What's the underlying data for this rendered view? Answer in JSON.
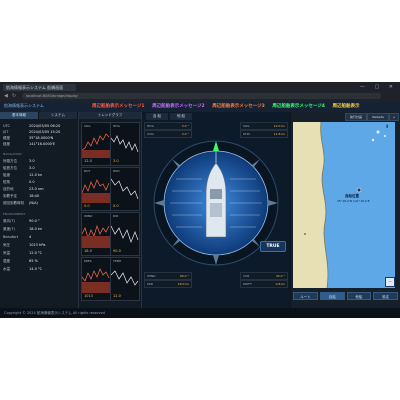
{
  "browser": {
    "tab_title": "航海情報表示システム 船橋画面",
    "url": "localhost:8080/bridge/display",
    "window_controls": "— ▢ ✕"
  },
  "app": {
    "title": "航海情報表示システム",
    "messages": [
      {
        "text": "周辺船舶表示メッセージ1",
        "color": "#ff5a3c"
      },
      {
        "text": "周辺船舶表示メッセージ2",
        "color": "#c86bff"
      },
      {
        "text": "周辺船舶表示メッセージ3",
        "color": "#ff7a3c"
      },
      {
        "text": "周辺船舶表示メッセージ4",
        "color": "#3cff6b"
      },
      {
        "text": "周辺船舶表示",
        "color": "#ffd23c"
      }
    ]
  },
  "left": {
    "tabs": [
      "基本情報",
      "システム"
    ],
    "rows": [
      {
        "k": "UTC",
        "v": "2024/03/05 06:20"
      },
      {
        "k": "JST",
        "v": "2024/03/05 15:20"
      },
      {
        "k": "緯度",
        "v": "35°18.0000'N"
      },
      {
        "k": "経度",
        "v": "141°16.0000'E"
      }
    ],
    "section1": "NAVIGATION",
    "rows2": [
      {
        "k": "針路方位",
        "v": "3.0"
      },
      {
        "k": "船首方位",
        "v": "3.0"
      },
      {
        "k": "船速",
        "v": "12.0 kn"
      },
      {
        "k": "舵角",
        "v": "0.0"
      },
      {
        "k": "目的地",
        "v": "23.0 nm"
      },
      {
        "k": "到着予定",
        "v": "18:40"
      },
      {
        "k": "前回到着時刻",
        "v": "(N/A)"
      }
    ],
    "section2": "ENVIRONMENT",
    "rows3": [
      {
        "k": "風向(T)",
        "v": "90.0 °"
      },
      {
        "k": "風速(T)",
        "v": "18.0 kn"
      },
      {
        "k": "Beaufort",
        "v": "4"
      },
      {
        "k": "気圧",
        "v": "1013 hPa"
      },
      {
        "k": "気温",
        "v": "12.0 °C"
      },
      {
        "k": "湿度",
        "v": "65 %"
      },
      {
        "k": "水温",
        "v": "14.0 °C"
      }
    ]
  },
  "trends": {
    "tab": "トレンドグラフ",
    "panels": [
      {
        "label": "SOG",
        "value": "12.0"
      },
      {
        "label": "HDG",
        "value": "3.0"
      },
      {
        "label": "ROT",
        "value": "0.0"
      },
      {
        "label": "RUD",
        "value": "0.0"
      },
      {
        "label": "WIND",
        "value": "18.0"
      },
      {
        "label": "DIR",
        "value": "90.0"
      },
      {
        "label": "PRES",
        "value": "1013"
      },
      {
        "label": "TEMP",
        "value": "12.0"
      }
    ]
  },
  "center": {
    "tabs": [
      "自 船",
      "他 船"
    ],
    "info_top": [
      {
        "l": "HDG",
        "r": "3.0 °"
      },
      {
        "l": "COG",
        "r": "3.0 °"
      },
      {
        "l": "SOG",
        "r": "12.0 kn"
      },
      {
        "l": "STW",
        "r": "11.8 kn"
      }
    ],
    "info_bottom": [
      {
        "l": "WIND",
        "r": "90.0 °"
      },
      {
        "l": "SPD",
        "r": "18.0 kn"
      },
      {
        "l": "CUR",
        "r": "45.0 °"
      },
      {
        "l": "DRIFT",
        "r": "0.8 kn"
      }
    ],
    "true_label": "TRUE",
    "compass_labels": [
      "N",
      "E",
      "S",
      "W"
    ]
  },
  "map": {
    "toolbar": [
      "航行計画",
      "Website",
      "+",
      "−"
    ],
    "ship_label": "自船位置",
    "ship_sub": "35°18.0'N 141°16.0'E",
    "buttons": [
      "ルート",
      "自船",
      "他船",
      "設定"
    ],
    "active_button": 1
  },
  "footer": "Copyright © 2024 航海情報表示システム All rights reserved"
}
